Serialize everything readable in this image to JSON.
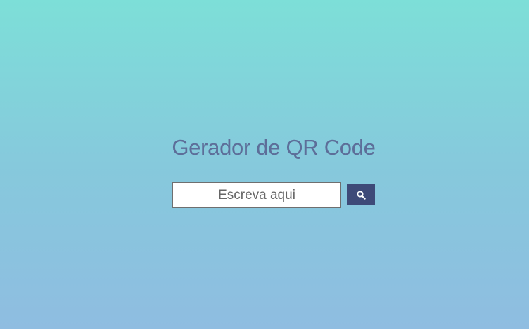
{
  "page": {
    "title": "Gerador de QR Code"
  },
  "search": {
    "placeholder": "Escreva aqui",
    "value": ""
  },
  "button": {
    "icon": "search-icon"
  },
  "colors": {
    "background_top": "#7ddfd8",
    "background_bottom": "#8fbde1",
    "title": "#5d6e99",
    "button": "#3e4a78"
  }
}
